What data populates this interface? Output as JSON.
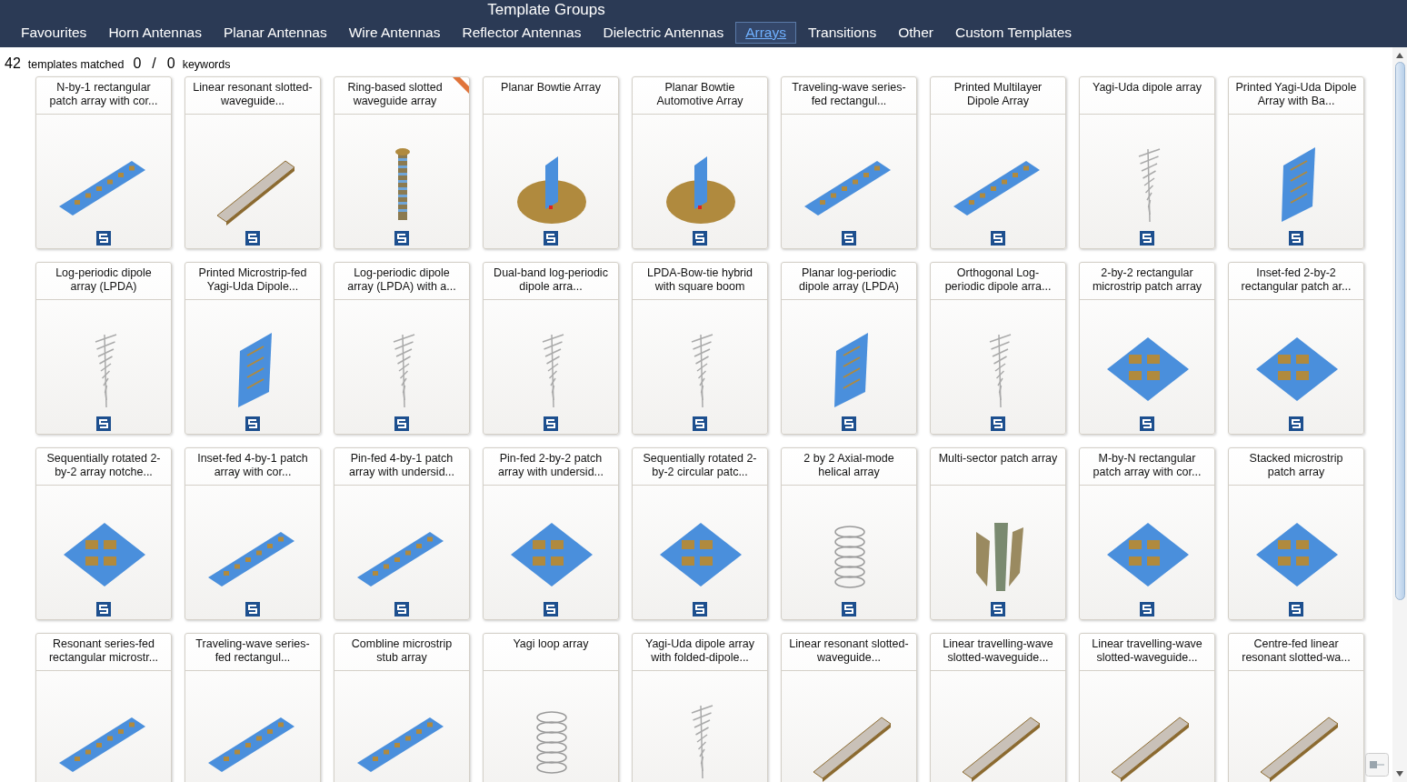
{
  "header": {
    "title": "Template Groups",
    "tabs": [
      {
        "label": "Favourites",
        "selected": false
      },
      {
        "label": "Horn Antennas",
        "selected": false
      },
      {
        "label": "Planar Antennas",
        "selected": false
      },
      {
        "label": "Wire Antennas",
        "selected": false
      },
      {
        "label": "Reflector Antennas",
        "selected": false
      },
      {
        "label": "Dielectric Antennas",
        "selected": false
      },
      {
        "label": "Arrays",
        "selected": true
      },
      {
        "label": "Transitions",
        "selected": false
      },
      {
        "label": "Other",
        "selected": false
      },
      {
        "label": "Custom Templates",
        "selected": false
      }
    ]
  },
  "summary": {
    "count": "42",
    "count_label": "templates matched",
    "matched": "0",
    "separator": "/",
    "total": "0",
    "total_label": "keywords"
  },
  "templates": [
    {
      "title": "N-by-1 rectangular patch array with cor...",
      "kind": "strip",
      "ribbon": false,
      "logo": true
    },
    {
      "title": "Linear resonant slotted-waveguide...",
      "kind": "waveguide",
      "ribbon": false,
      "logo": true
    },
    {
      "title": "Ring-based slotted waveguide array",
      "kind": "rod",
      "ribbon": true,
      "logo": true
    },
    {
      "title": "Planar Bowtie Array",
      "kind": "disc",
      "ribbon": false,
      "logo": true
    },
    {
      "title": "Planar Bowtie Automotive Array",
      "kind": "disc",
      "ribbon": false,
      "logo": true
    },
    {
      "title": "Traveling-wave series-fed rectangul...",
      "kind": "strip",
      "ribbon": false,
      "logo": true
    },
    {
      "title": "Printed Multilayer Dipole Array",
      "kind": "strip",
      "ribbon": false,
      "logo": true
    },
    {
      "title": "Yagi-Uda dipole array",
      "kind": "wire",
      "ribbon": false,
      "logo": true
    },
    {
      "title": "Printed Yagi-Uda Dipole Array with Ba...",
      "kind": "panel",
      "ribbon": false,
      "logo": true
    },
    {
      "title": "Log-periodic dipole array (LPDA)",
      "kind": "wire",
      "ribbon": false,
      "logo": true
    },
    {
      "title": "Printed Microstrip-fed Yagi-Uda Dipole...",
      "kind": "panel",
      "ribbon": false,
      "logo": true
    },
    {
      "title": "Log-periodic dipole array (LPDA) with a...",
      "kind": "wire",
      "ribbon": false,
      "logo": true
    },
    {
      "title": "Dual-band log-periodic dipole arra...",
      "kind": "wire",
      "ribbon": false,
      "logo": true
    },
    {
      "title": "LPDA-Bow-tie hybrid with square boom",
      "kind": "wire",
      "ribbon": false,
      "logo": true
    },
    {
      "title": "Planar log-periodic dipole array (LPDA)",
      "kind": "panel",
      "ribbon": false,
      "logo": true
    },
    {
      "title": "Orthogonal Log-periodic dipole arra...",
      "kind": "wire",
      "ribbon": false,
      "logo": true
    },
    {
      "title": "2-by-2 rectangular microstrip patch array",
      "kind": "square",
      "ribbon": false,
      "logo": true
    },
    {
      "title": "Inset-fed 2-by-2 rectangular patch ar...",
      "kind": "square",
      "ribbon": false,
      "logo": true
    },
    {
      "title": "Sequentially rotated 2-by-2 array notche...",
      "kind": "square",
      "ribbon": false,
      "logo": true
    },
    {
      "title": "Inset-fed 4-by-1 patch array with cor...",
      "kind": "strip",
      "ribbon": false,
      "logo": true
    },
    {
      "title": "Pin-fed 4-by-1 patch array with undersid...",
      "kind": "strip",
      "ribbon": false,
      "logo": true
    },
    {
      "title": "Pin-fed 2-by-2 patch array with undersid...",
      "kind": "square",
      "ribbon": false,
      "logo": true
    },
    {
      "title": "Sequentially rotated 2-by-2 circular patc...",
      "kind": "square",
      "ribbon": false,
      "logo": true
    },
    {
      "title": "2 by 2 Axial-mode helical array",
      "kind": "helix",
      "ribbon": false,
      "logo": true
    },
    {
      "title": "Multi-sector patch array",
      "kind": "sector",
      "ribbon": false,
      "logo": true
    },
    {
      "title": "M-by-N rectangular patch array with cor...",
      "kind": "square",
      "ribbon": false,
      "logo": true
    },
    {
      "title": "Stacked microstrip patch array",
      "kind": "square",
      "ribbon": false,
      "logo": true
    },
    {
      "title": "Resonant series-fed rectangular microstr...",
      "kind": "strip",
      "ribbon": false,
      "logo": false
    },
    {
      "title": "Traveling-wave series-fed rectangul...",
      "kind": "strip",
      "ribbon": false,
      "logo": false
    },
    {
      "title": "Combline microstrip stub array",
      "kind": "strip",
      "ribbon": false,
      "logo": false
    },
    {
      "title": "Yagi loop array",
      "kind": "helix",
      "ribbon": false,
      "logo": false
    },
    {
      "title": "Yagi-Uda dipole array with folded-dipole...",
      "kind": "wire",
      "ribbon": false,
      "logo": false
    },
    {
      "title": "Linear resonant slotted-waveguide...",
      "kind": "waveguide",
      "ribbon": false,
      "logo": false
    },
    {
      "title": "Linear travelling-wave slotted-waveguide...",
      "kind": "waveguide",
      "ribbon": false,
      "logo": false
    },
    {
      "title": "Linear travelling-wave slotted-waveguide...",
      "kind": "waveguide",
      "ribbon": false,
      "logo": false
    },
    {
      "title": "Centre-fed linear resonant slotted-wa...",
      "kind": "waveguide",
      "ribbon": false,
      "logo": false
    }
  ]
}
